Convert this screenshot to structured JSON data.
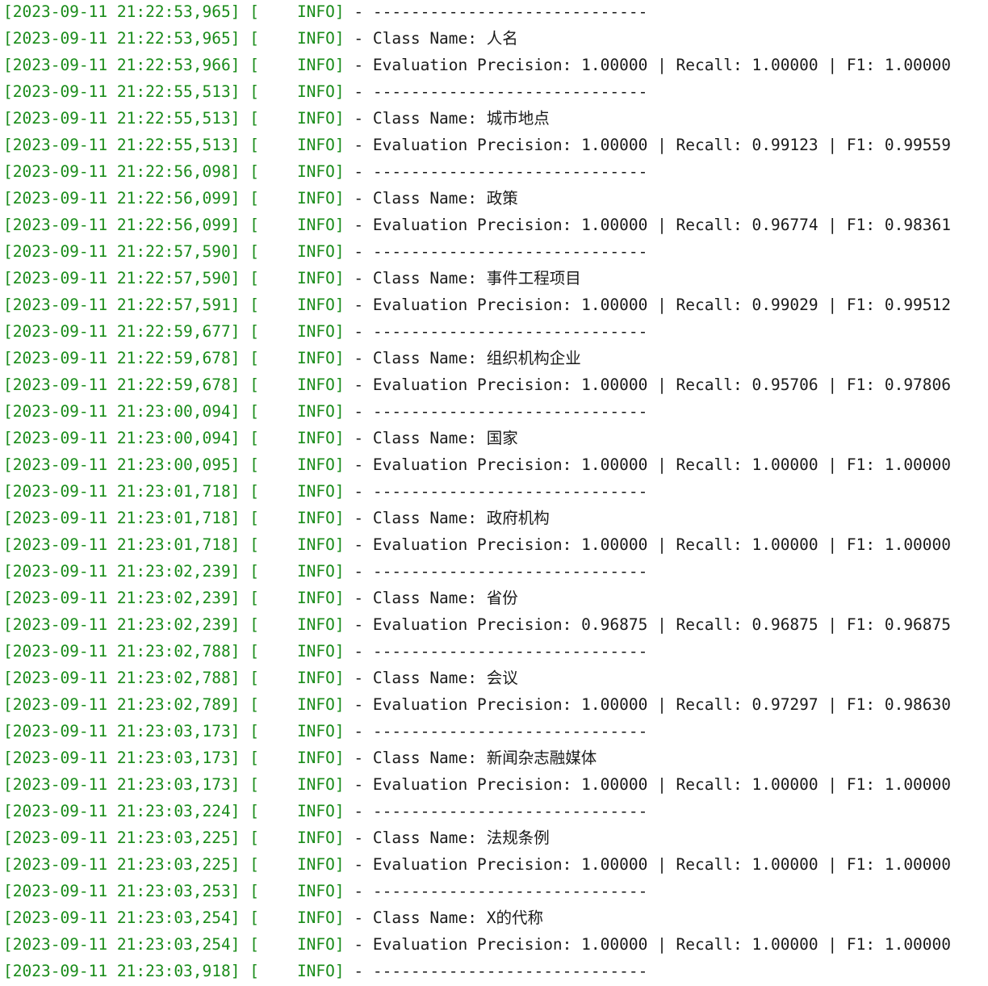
{
  "log": {
    "lines": [
      {
        "ts": "[2023-09-11 21:22:53,965] [",
        "lvl": "    INFO]",
        "msg": " - -----------------------------"
      },
      {
        "ts": "[2023-09-11 21:22:53,965] [",
        "lvl": "    INFO]",
        "msg": " - Class Name: 人名"
      },
      {
        "ts": "[2023-09-11 21:22:53,966] [",
        "lvl": "    INFO]",
        "msg": " - Evaluation Precision: 1.00000 | Recall: 1.00000 | F1: 1.00000"
      },
      {
        "ts": "[2023-09-11 21:22:55,513] [",
        "lvl": "    INFO]",
        "msg": " - -----------------------------"
      },
      {
        "ts": "[2023-09-11 21:22:55,513] [",
        "lvl": "    INFO]",
        "msg": " - Class Name: 城市地点"
      },
      {
        "ts": "[2023-09-11 21:22:55,513] [",
        "lvl": "    INFO]",
        "msg": " - Evaluation Precision: 1.00000 | Recall: 0.99123 | F1: 0.99559"
      },
      {
        "ts": "[2023-09-11 21:22:56,098] [",
        "lvl": "    INFO]",
        "msg": " - -----------------------------"
      },
      {
        "ts": "[2023-09-11 21:22:56,099] [",
        "lvl": "    INFO]",
        "msg": " - Class Name: 政策"
      },
      {
        "ts": "[2023-09-11 21:22:56,099] [",
        "lvl": "    INFO]",
        "msg": " - Evaluation Precision: 1.00000 | Recall: 0.96774 | F1: 0.98361"
      },
      {
        "ts": "[2023-09-11 21:22:57,590] [",
        "lvl": "    INFO]",
        "msg": " - -----------------------------"
      },
      {
        "ts": "[2023-09-11 21:22:57,590] [",
        "lvl": "    INFO]",
        "msg": " - Class Name: 事件工程项目"
      },
      {
        "ts": "[2023-09-11 21:22:57,591] [",
        "lvl": "    INFO]",
        "msg": " - Evaluation Precision: 1.00000 | Recall: 0.99029 | F1: 0.99512"
      },
      {
        "ts": "[2023-09-11 21:22:59,677] [",
        "lvl": "    INFO]",
        "msg": " - -----------------------------"
      },
      {
        "ts": "[2023-09-11 21:22:59,678] [",
        "lvl": "    INFO]",
        "msg": " - Class Name: 组织机构企业"
      },
      {
        "ts": "[2023-09-11 21:22:59,678] [",
        "lvl": "    INFO]",
        "msg": " - Evaluation Precision: 1.00000 | Recall: 0.95706 | F1: 0.97806"
      },
      {
        "ts": "[2023-09-11 21:23:00,094] [",
        "lvl": "    INFO]",
        "msg": " - -----------------------------"
      },
      {
        "ts": "[2023-09-11 21:23:00,094] [",
        "lvl": "    INFO]",
        "msg": " - Class Name: 国家"
      },
      {
        "ts": "[2023-09-11 21:23:00,095] [",
        "lvl": "    INFO]",
        "msg": " - Evaluation Precision: 1.00000 | Recall: 1.00000 | F1: 1.00000"
      },
      {
        "ts": "[2023-09-11 21:23:01,718] [",
        "lvl": "    INFO]",
        "msg": " - -----------------------------"
      },
      {
        "ts": "[2023-09-11 21:23:01,718] [",
        "lvl": "    INFO]",
        "msg": " - Class Name: 政府机构"
      },
      {
        "ts": "[2023-09-11 21:23:01,718] [",
        "lvl": "    INFO]",
        "msg": " - Evaluation Precision: 1.00000 | Recall: 1.00000 | F1: 1.00000"
      },
      {
        "ts": "[2023-09-11 21:23:02,239] [",
        "lvl": "    INFO]",
        "msg": " - -----------------------------"
      },
      {
        "ts": "[2023-09-11 21:23:02,239] [",
        "lvl": "    INFO]",
        "msg": " - Class Name: 省份"
      },
      {
        "ts": "[2023-09-11 21:23:02,239] [",
        "lvl": "    INFO]",
        "msg": " - Evaluation Precision: 0.96875 | Recall: 0.96875 | F1: 0.96875"
      },
      {
        "ts": "[2023-09-11 21:23:02,788] [",
        "lvl": "    INFO]",
        "msg": " - -----------------------------"
      },
      {
        "ts": "[2023-09-11 21:23:02,788] [",
        "lvl": "    INFO]",
        "msg": " - Class Name: 会议"
      },
      {
        "ts": "[2023-09-11 21:23:02,789] [",
        "lvl": "    INFO]",
        "msg": " - Evaluation Precision: 1.00000 | Recall: 0.97297 | F1: 0.98630"
      },
      {
        "ts": "[2023-09-11 21:23:03,173] [",
        "lvl": "    INFO]",
        "msg": " - -----------------------------"
      },
      {
        "ts": "[2023-09-11 21:23:03,173] [",
        "lvl": "    INFO]",
        "msg": " - Class Name: 新闻杂志融媒体"
      },
      {
        "ts": "[2023-09-11 21:23:03,173] [",
        "lvl": "    INFO]",
        "msg": " - Evaluation Precision: 1.00000 | Recall: 1.00000 | F1: 1.00000"
      },
      {
        "ts": "[2023-09-11 21:23:03,224] [",
        "lvl": "    INFO]",
        "msg": " - -----------------------------"
      },
      {
        "ts": "[2023-09-11 21:23:03,225] [",
        "lvl": "    INFO]",
        "msg": " - Class Name: 法规条例"
      },
      {
        "ts": "[2023-09-11 21:23:03,225] [",
        "lvl": "    INFO]",
        "msg": " - Evaluation Precision: 1.00000 | Recall: 1.00000 | F1: 1.00000"
      },
      {
        "ts": "[2023-09-11 21:23:03,253] [",
        "lvl": "    INFO]",
        "msg": " - -----------------------------"
      },
      {
        "ts": "[2023-09-11 21:23:03,254] [",
        "lvl": "    INFO]",
        "msg": " - Class Name: X的代称"
      },
      {
        "ts": "[2023-09-11 21:23:03,254] [",
        "lvl": "    INFO]",
        "msg": " - Evaluation Precision: 1.00000 | Recall: 1.00000 | F1: 1.00000"
      },
      {
        "ts": "[2023-09-11 21:23:03,918] [",
        "lvl": "    INFO]",
        "msg": " - -----------------------------"
      }
    ]
  },
  "colors": {
    "timestamp": "#1a8c1a",
    "level": "#1a8c1a",
    "message": "#1a1a1a",
    "background": "#ffffff"
  }
}
